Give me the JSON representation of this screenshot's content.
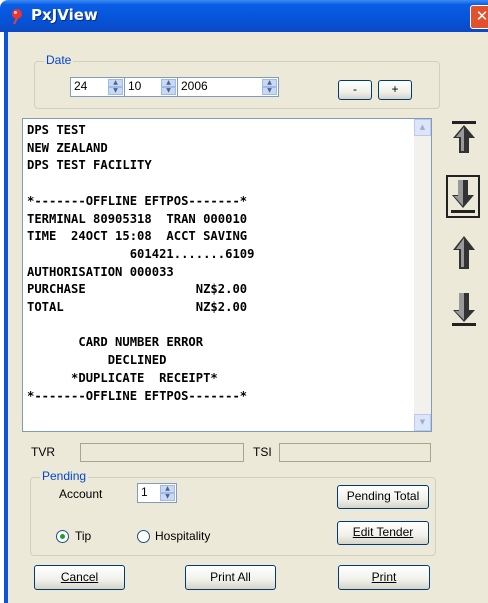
{
  "window": {
    "title": "PxJView",
    "close_glyph": "✕"
  },
  "date": {
    "group_label": "Date",
    "day": "24",
    "month": "10",
    "year": "2006",
    "minus_label": "-",
    "plus_label": "+"
  },
  "receipt": {
    "lines": "DPS TEST\nNEW ZEALAND\nDPS TEST FACILITY\n\n*-------OFFLINE EFTPOS-------*\nTERMINAL 80905318  TRAN 000010\nTIME  24OCT 15:08  ACCT SAVING\n              601421.......6109\nAUTHORISATION 000033\nPURCHASE               NZ$2.00\nTOTAL                  NZ$2.00\n\n       CARD NUMBER ERROR\n           DECLINED\n      *DUPLICATE  RECEIPT*\n*-------OFFLINE EFTPOS-------*"
  },
  "nav_icons": [
    "first-arrow-icon",
    "last-arrow-icon",
    "prev-arrow-icon",
    "next-arrow-icon"
  ],
  "tvr_label": "TVR",
  "tsi_label": "TSI",
  "pending": {
    "group_label": "Pending",
    "account_label": "Account",
    "account_value": "1",
    "pending_total_label": "Pending Total",
    "edit_tender_label": "Edit Tender",
    "tip_label": "Tip",
    "hospitality_label": "Hospitality",
    "selected": "Tip"
  },
  "footer": {
    "cancel_label": "Cancel",
    "print_all_label": "Print All",
    "print_label": "Print"
  },
  "colors": {
    "titlebar": "#0554d9",
    "face": "#ece9d8",
    "group_label": "#0046d5",
    "close": "#e2512e"
  }
}
